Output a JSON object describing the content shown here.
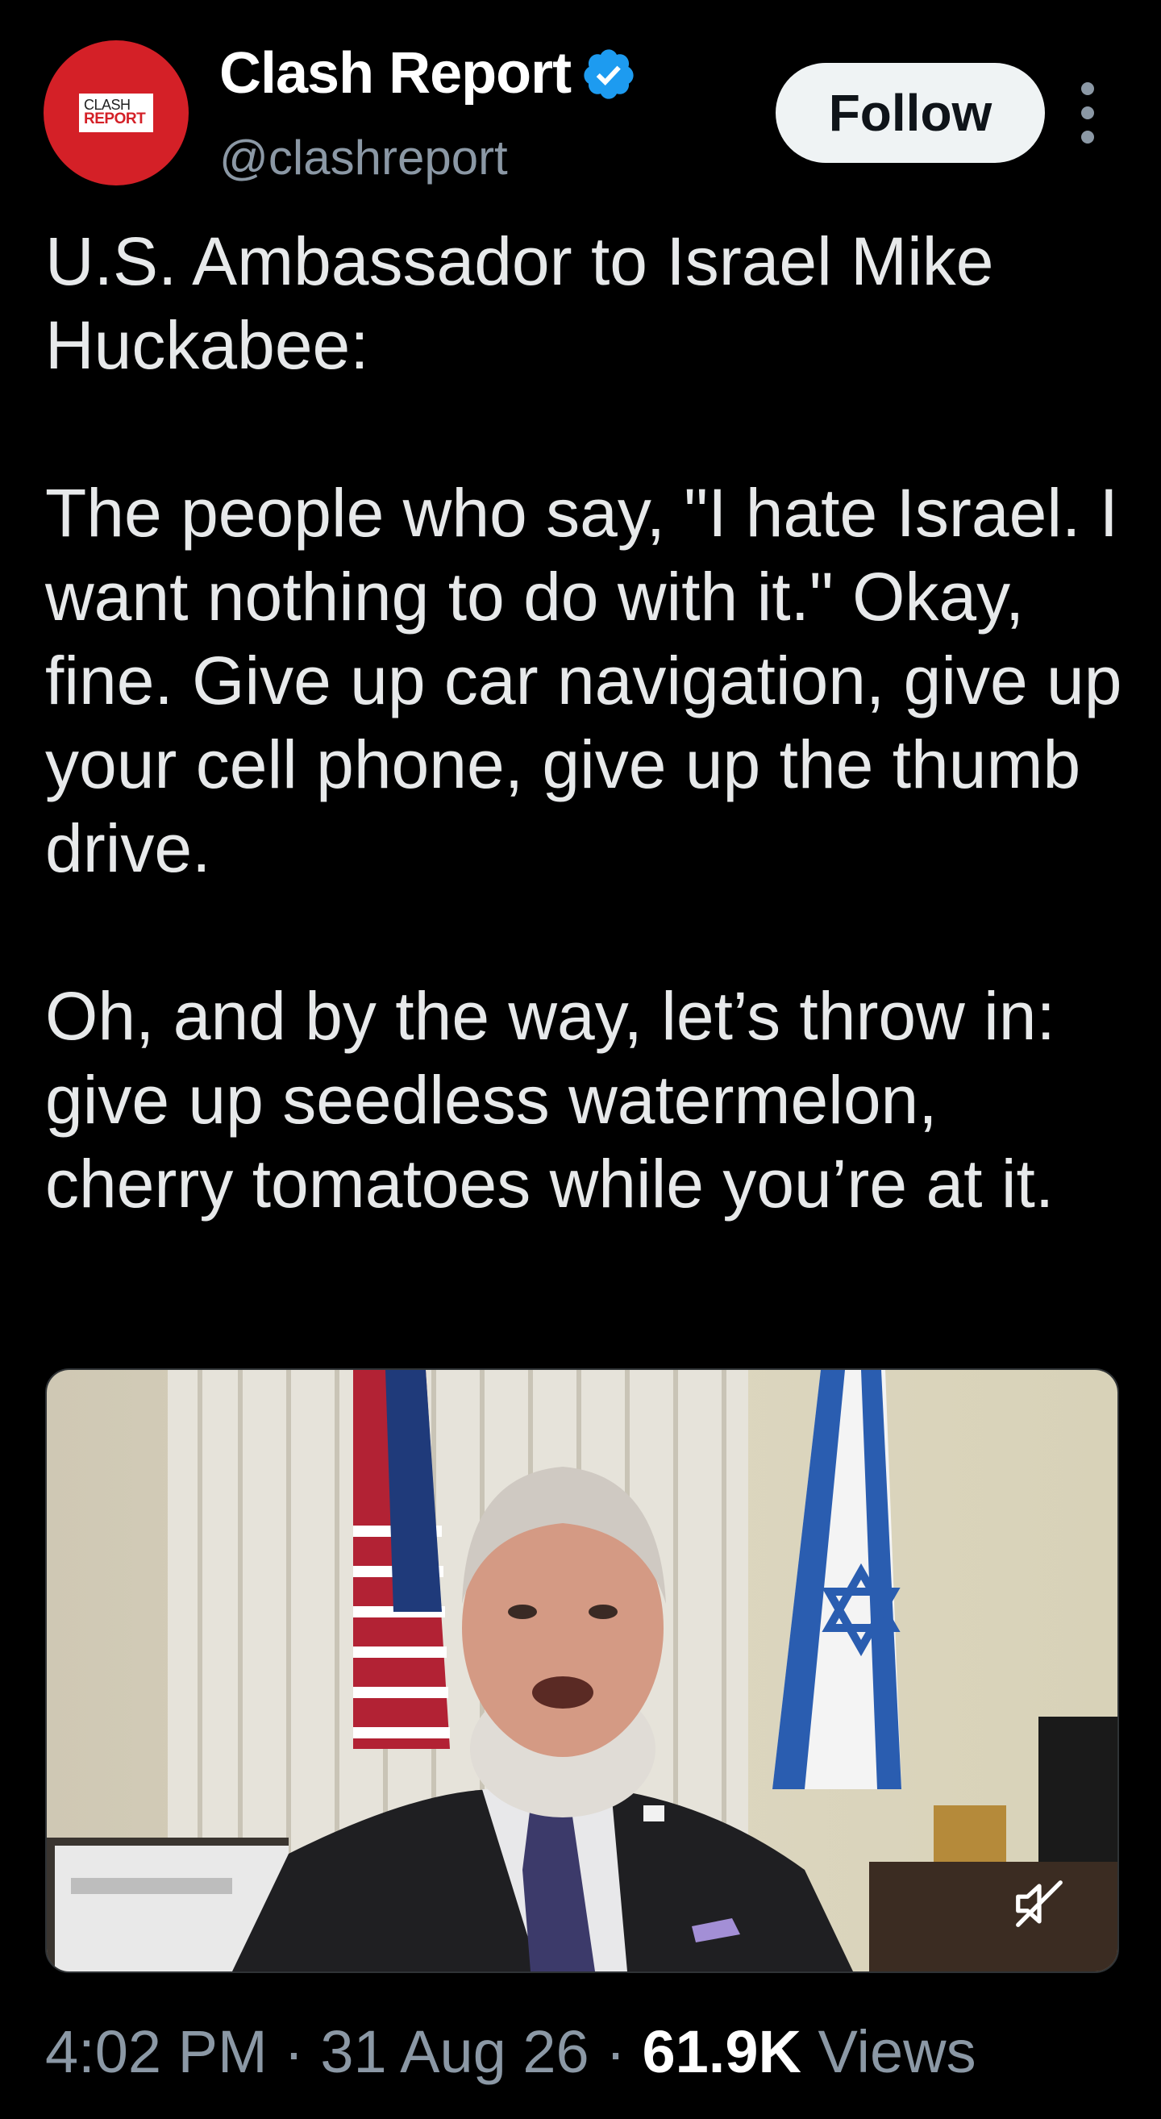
{
  "header": {
    "avatar": {
      "line1": "CLASH",
      "line2": "REPORT",
      "color": "#d42027"
    },
    "display_name": "Clash Report",
    "verified": true,
    "verified_icon": "verified-badge-icon",
    "handle": "@clashreport",
    "follow_label": "Follow",
    "more_icon": "more-vertical-icon"
  },
  "tweet": {
    "paragraphs": [
      "U.S. Ambassador to Israel Mike Huckabee:",
      "The people who say, \"I hate Israel. I want nothing to do with it.\" Okay, fine. Give up car navigation, give up your cell phone, give up the thumb drive.",
      "Oh, and by the way, let’s throw in: give up seedless watermelon, cherry tomatoes while you’re at it."
    ]
  },
  "media": {
    "type": "video",
    "mute_icon": "volume-muted-icon"
  },
  "meta": {
    "time": "4:02 PM",
    "separator": "·",
    "date": "31 Aug 26",
    "views_count": "61.9K",
    "views_label": "Views"
  },
  "colors": {
    "background": "#000000",
    "text": "#e7e9ea",
    "secondary": "#8b98a5",
    "verified": "#1d9bf0"
  }
}
